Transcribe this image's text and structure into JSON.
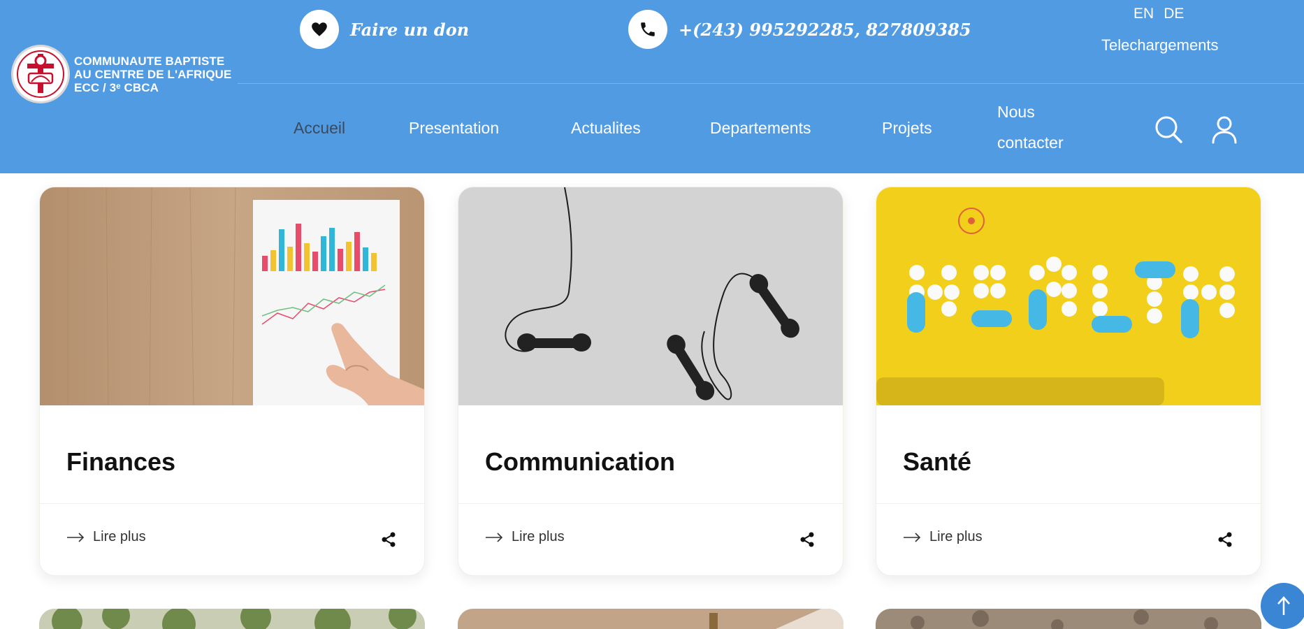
{
  "header": {
    "logo": {
      "lines": [
        "COMMUNAUTE BAPTISTE",
        "AU CENTRE DE L'AFRIQUE",
        "ECC / 3ᵉ CBCA"
      ],
      "icon": "church-cross-logo"
    },
    "donate": {
      "icon": "heart-icon",
      "label": "Faire un don"
    },
    "phone": {
      "icon": "phone-icon",
      "label": "+(243) 995292285, 827809385"
    },
    "languages": [
      "EN",
      "DE"
    ],
    "downloads_label": "Telechargements",
    "nav": {
      "items": [
        {
          "label": "Accueil",
          "active": true
        },
        {
          "label": "Presentation",
          "active": false
        },
        {
          "label": "Actualites",
          "active": false
        },
        {
          "label": "Departements",
          "active": false
        },
        {
          "label": "Projets",
          "active": false
        },
        {
          "label": "Nous contacter",
          "active": false
        }
      ],
      "search_icon": "search-icon",
      "account_icon": "user-icon"
    },
    "colors": {
      "bar": "#519be3",
      "active_nav": "#3b4a5c"
    }
  },
  "cards": [
    {
      "title": "Finances",
      "image": "finance-chart-photo",
      "read_more": "Lire plus",
      "share_icon": "share-icon"
    },
    {
      "title": "Communication",
      "image": "telephone-receivers-photo",
      "read_more": "Lire plus",
      "share_icon": "share-icon"
    },
    {
      "title": "Santé",
      "image": "health-pills-photo",
      "read_more": "Lire plus",
      "share_icon": "share-icon"
    }
  ],
  "back_to_top_icon": "arrow-up-icon"
}
